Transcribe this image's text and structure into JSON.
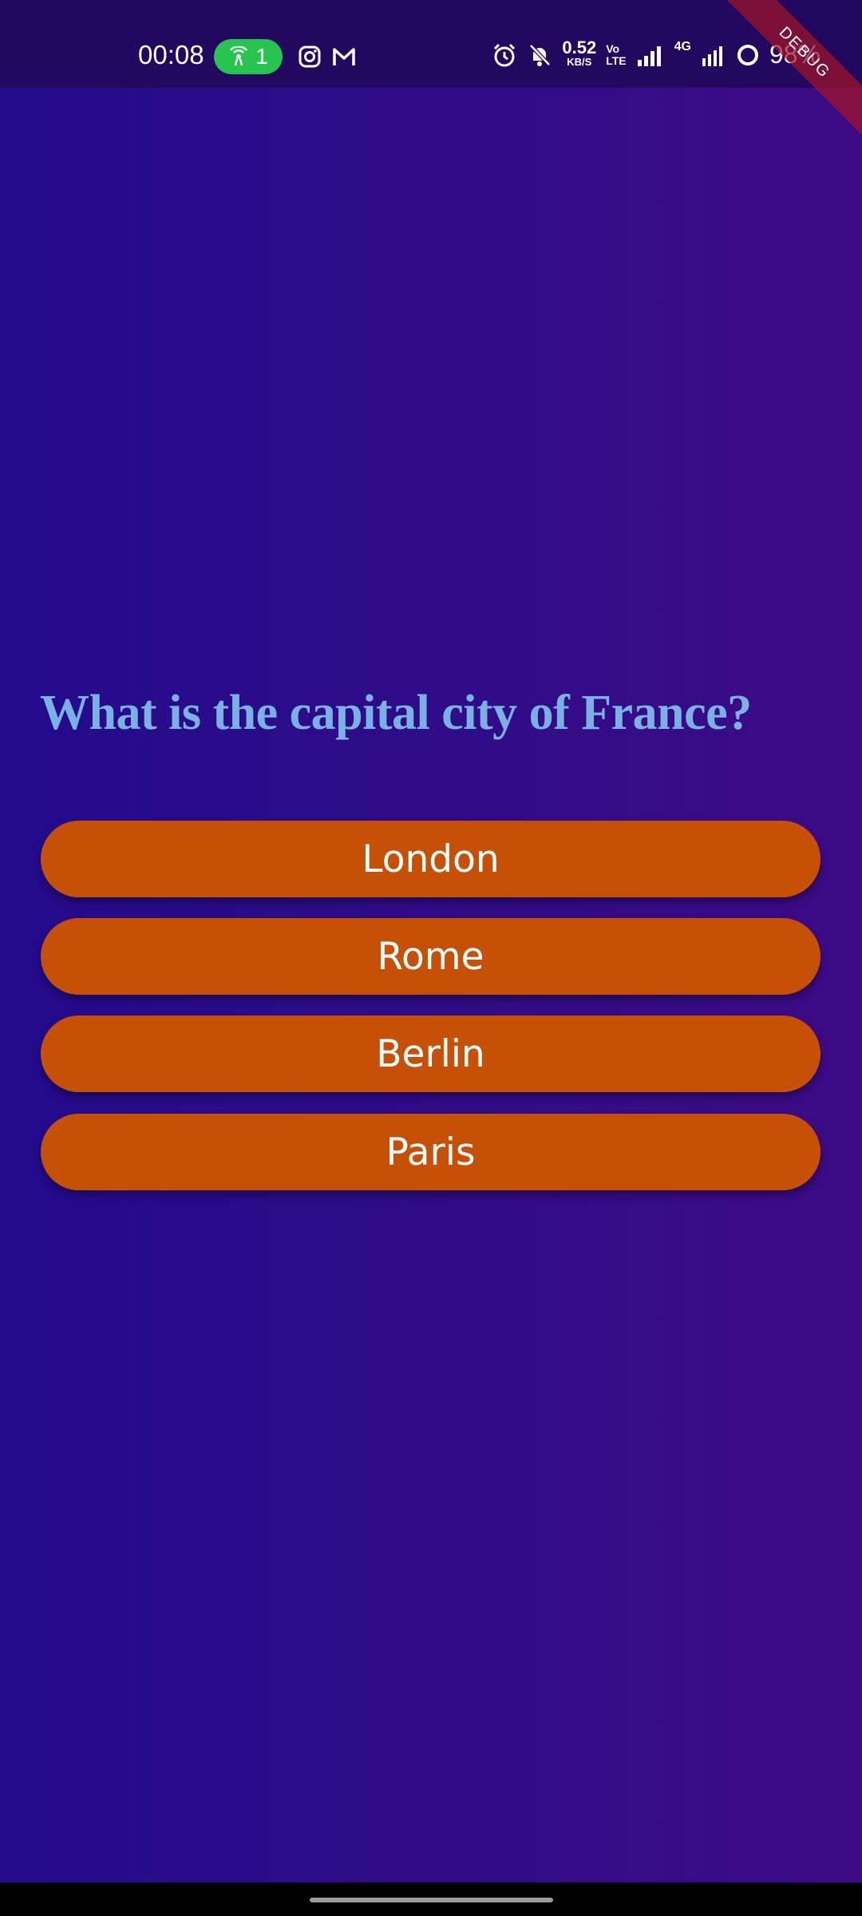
{
  "status_bar": {
    "time": "00:08",
    "hotspot_count": "1",
    "net_speed_value": "0.52",
    "net_speed_unit": "KB/S",
    "volte_top": "Vo",
    "volte_bottom": "LTE",
    "network_type": "4G",
    "battery": "98%"
  },
  "debug_label": "DEBUG",
  "quiz": {
    "question": "What is the capital city of France?",
    "answers": [
      "London",
      "Rome",
      "Berlin",
      "Paris"
    ]
  },
  "colors": {
    "background_start": "#230b8c",
    "background_end": "#3d0b86",
    "question_text": "#7ab0e3",
    "answer_button": "#c65106",
    "answer_text": "#ffffff",
    "hotspot_pill": "#27c44f"
  }
}
